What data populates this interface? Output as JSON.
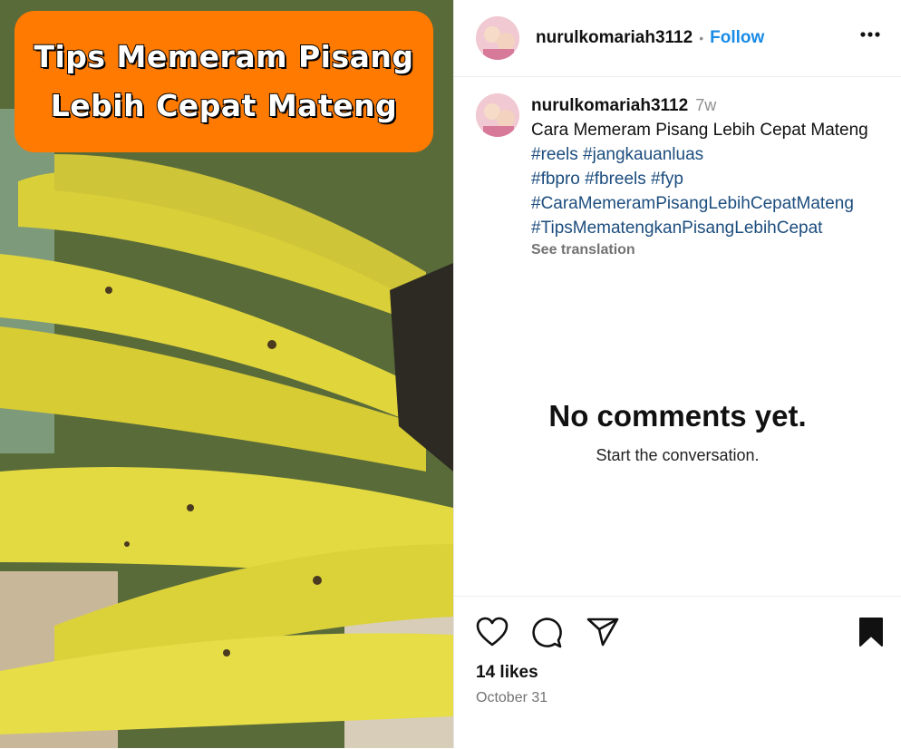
{
  "post": {
    "overlay_text": "Tips Memeram Pisang Lebih Cepat Mateng"
  },
  "header": {
    "username": "nurulkomariah3112",
    "separator": "•",
    "follow_label": "Follow",
    "more_icon": "more-horizontal-icon"
  },
  "caption": {
    "username": "nurulkomariah3112",
    "time": "7w",
    "text": "Cara Memeram Pisang Lebih Cepat Mateng",
    "hashtags_line1": "#reels #jangkauanluas",
    "hashtags_line2": "#fbpro #fbreels #fyp",
    "hashtags_line3": "#CaraMemeramPisangLebihCepatMateng",
    "hashtags_line4": "#TipsMematengkanPisangLebihCepat",
    "see_translation": "See translation"
  },
  "comments": {
    "empty_title": "No comments yet.",
    "empty_subtitle": "Start the conversation."
  },
  "actions": {
    "like_icon": "heart-icon",
    "comment_icon": "comment-icon",
    "share_icon": "share-icon",
    "save_icon": "bookmark-icon",
    "likes": "14 likes",
    "date": "October 31"
  },
  "colors": {
    "follow": "#1a8be6",
    "hashtag": "#1c4d7e",
    "overlay_bg": "#ff7a00"
  }
}
